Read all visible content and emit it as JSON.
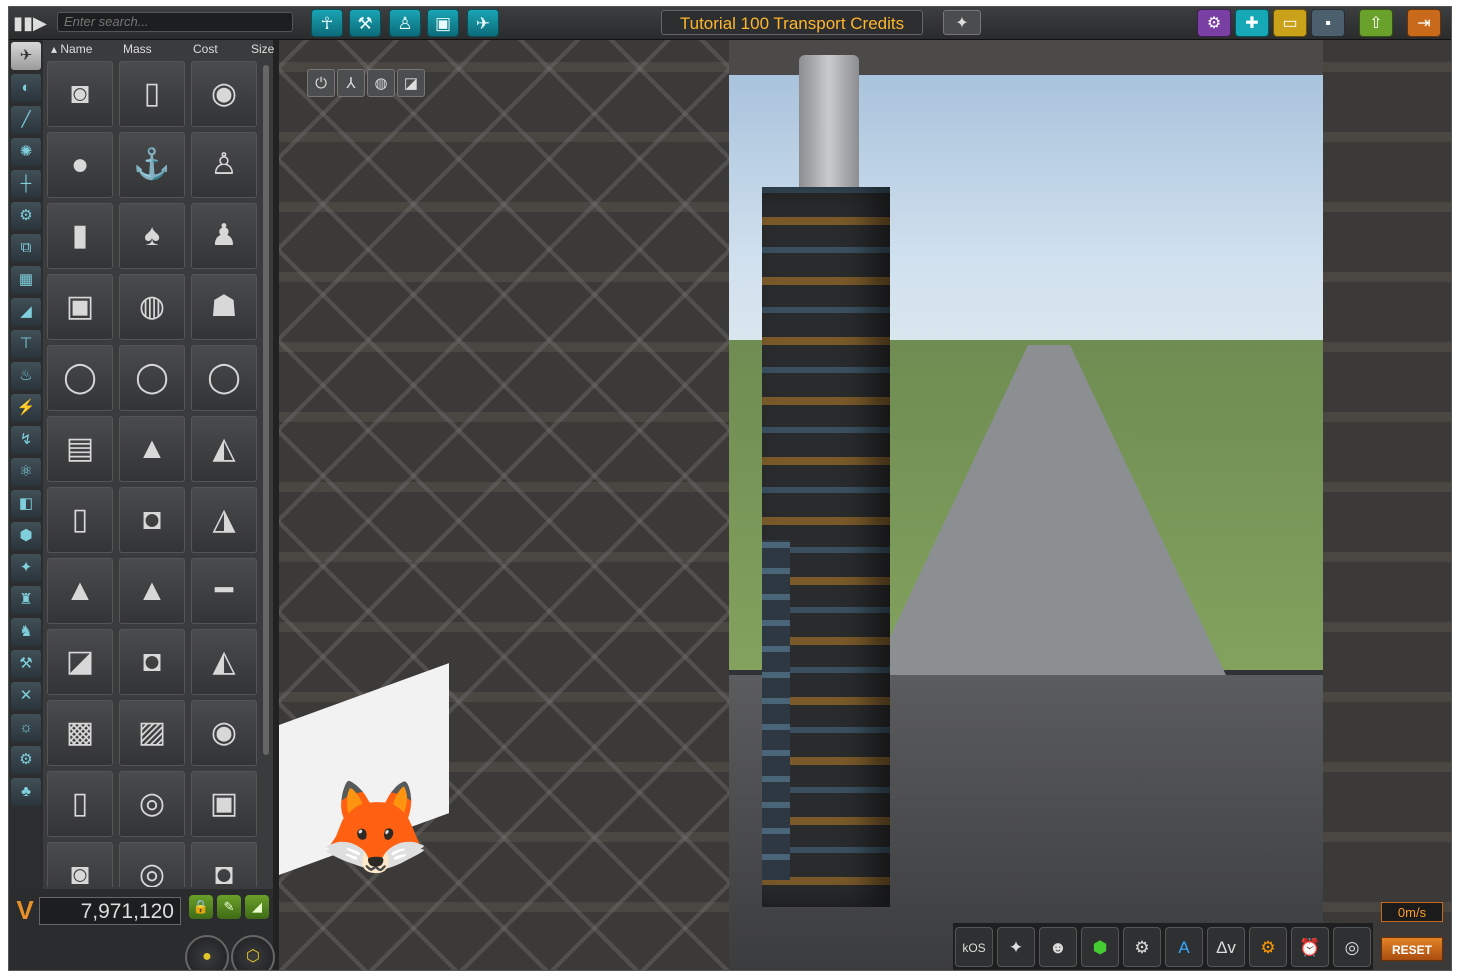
{
  "search": {
    "placeholder": "Enter search..."
  },
  "header": {
    "title": "Tutorial 100 Transport Credits"
  },
  "columns": [
    "Name",
    "Mass",
    "Cost",
    "Size"
  ],
  "funds": "7,971,120",
  "speed": "0m/s",
  "reset_label": "RESET",
  "app_labels": {
    "kos": "kOS",
    "dv": "Δv"
  },
  "menu_icon": "three-bars-arrow-icon",
  "top_categories": [
    "kerbal-eva-icon",
    "wrench-hammer-icon",
    "pod-icon",
    "cube-icon",
    "plane-icon"
  ],
  "right_buttons": [
    {
      "name": "steam-button",
      "icon": "steam-icon",
      "color": "#7a3fa3"
    },
    {
      "name": "new-craft-button",
      "icon": "new-file-icon",
      "color": "#16a8b6"
    },
    {
      "name": "load-craft-button",
      "icon": "folder-icon",
      "color": "#c9a21a"
    },
    {
      "name": "save-craft-button",
      "icon": "floppy-icon",
      "color": "#4c5f6d"
    },
    {
      "name": "launch-button",
      "icon": "launchpad-icon",
      "color": "#6aa12a"
    },
    {
      "name": "exit-button",
      "icon": "exit-icon",
      "color": "#c96a1a"
    }
  ],
  "part_categories": [
    "pods-icon",
    "fuel-tank-icon",
    "engine-icon",
    "control-icon",
    "structural-icon",
    "robotics-icon",
    "coupling-icon",
    "payload-icon",
    "aero-icon",
    "ground-icon",
    "thermal-icon",
    "electrical-icon",
    "communication-icon",
    "science-icon",
    "cargo-icon",
    "utility-icon",
    "fox-icon",
    "mod-icon",
    "mod-icon-2",
    "mod-icon-3",
    "wrench-icon",
    "light-icon",
    "rover-icon",
    "leaf-icon"
  ],
  "parts": [
    "mk1-pod",
    "fuel-tank",
    "gold-canister",
    "orange-sphere",
    "landing-leg",
    "small-capsule",
    "probe-core",
    "red-dome-capsule",
    "white-capsule",
    "service-bay",
    "glass-dome-pod",
    "gold-pod",
    "round-probe-1",
    "round-probe-2",
    "round-probe-3",
    "square-probe",
    "cone-probe",
    "command-pod",
    "blue-cylinder",
    "grey-drum",
    "pilot-pod",
    "nose-cone",
    "black-cone",
    "rocket-body",
    "hatch-pod",
    "white-drum",
    "eva-pod",
    "cube-module",
    "hub-module",
    "round-module",
    "tank-module",
    "disc-module",
    "dock-module",
    "drum-1",
    "drum-2",
    "drum-3"
  ]
}
